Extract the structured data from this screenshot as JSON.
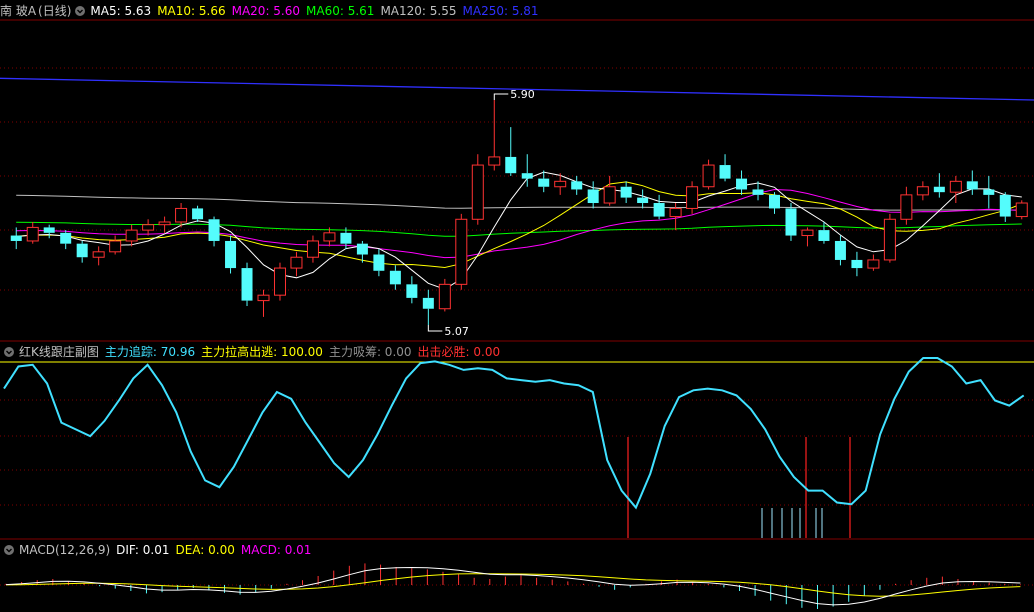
{
  "price_panel": {
    "stock_name": "南 玻A",
    "period": "(日线)",
    "ma_items": [
      {
        "label": "MA5: 5.63",
        "color": "#ffffff"
      },
      {
        "label": "MA10: 5.66",
        "color": "#ffff00"
      },
      {
        "label": "MA20: 5.60",
        "color": "#ff00ff"
      },
      {
        "label": "MA60: 5.61",
        "color": "#00ff00"
      },
      {
        "label": "MA120: 5.55",
        "color": "#c0c0c0"
      },
      {
        "label": "MA250: 5.81",
        "color": "#3030ff"
      }
    ],
    "high_label": "5.90",
    "low_label": "5.07"
  },
  "indicator_panel": {
    "title": "红K线跟庄副图",
    "items": [
      {
        "label": "主力追踪: 70.96",
        "color": "#40e0ff"
      },
      {
        "label": "主力拉高出逃: 100.00",
        "color": "#ffff00"
      },
      {
        "label": "主力吸筹: 0.00",
        "color": "#909090"
      },
      {
        "label": "出击必胜: 0.00",
        "color": "#ff3030"
      }
    ]
  },
  "macd_panel": {
    "title": "MACD(12,26,9)",
    "items": [
      {
        "label": "DIF: 0.01",
        "color": "#ffffff"
      },
      {
        "label": "DEA: 0.00",
        "color": "#ffff00"
      },
      {
        "label": "MACD: 0.01",
        "color": "#ff00ff"
      }
    ]
  },
  "colors": {
    "up": "#ff3232",
    "down": "#54fcfc",
    "grid": "#800000",
    "track": "#40e0ff"
  },
  "chart_data": {
    "type": "candlestick",
    "price_range": [
      5.07,
      5.9
    ],
    "candles": [
      [
        5.4,
        5.43,
        5.35,
        5.38
      ],
      [
        5.38,
        5.45,
        5.37,
        5.43
      ],
      [
        5.43,
        5.44,
        5.39,
        5.41
      ],
      [
        5.41,
        5.42,
        5.35,
        5.37
      ],
      [
        5.37,
        5.38,
        5.3,
        5.32
      ],
      [
        5.32,
        5.36,
        5.29,
        5.34
      ],
      [
        5.34,
        5.4,
        5.33,
        5.38
      ],
      [
        5.38,
        5.44,
        5.36,
        5.42
      ],
      [
        5.42,
        5.46,
        5.4,
        5.44
      ],
      [
        5.44,
        5.47,
        5.41,
        5.45
      ],
      [
        5.45,
        5.52,
        5.43,
        5.5
      ],
      [
        5.5,
        5.51,
        5.45,
        5.46
      ],
      [
        5.46,
        5.47,
        5.36,
        5.38
      ],
      [
        5.38,
        5.4,
        5.26,
        5.28
      ],
      [
        5.28,
        5.3,
        5.14,
        5.16
      ],
      [
        5.16,
        5.2,
        5.1,
        5.18
      ],
      [
        5.18,
        5.3,
        5.16,
        5.28
      ],
      [
        5.28,
        5.34,
        5.25,
        5.32
      ],
      [
        5.32,
        5.4,
        5.3,
        5.38
      ],
      [
        5.38,
        5.43,
        5.36,
        5.41
      ],
      [
        5.41,
        5.43,
        5.35,
        5.37
      ],
      [
        5.37,
        5.38,
        5.3,
        5.33
      ],
      [
        5.33,
        5.35,
        5.25,
        5.27
      ],
      [
        5.27,
        5.29,
        5.2,
        5.22
      ],
      [
        5.22,
        5.25,
        5.15,
        5.17
      ],
      [
        5.17,
        5.2,
        5.07,
        5.13
      ],
      [
        5.13,
        5.24,
        5.12,
        5.22
      ],
      [
        5.22,
        5.48,
        5.2,
        5.46
      ],
      [
        5.46,
        5.7,
        5.44,
        5.66
      ],
      [
        5.66,
        5.9,
        5.64,
        5.69
      ],
      [
        5.69,
        5.8,
        5.62,
        5.63
      ],
      [
        5.63,
        5.7,
        5.58,
        5.61
      ],
      [
        5.61,
        5.64,
        5.56,
        5.58
      ],
      [
        5.58,
        5.63,
        5.55,
        5.6
      ],
      [
        5.6,
        5.62,
        5.55,
        5.57
      ],
      [
        5.57,
        5.6,
        5.5,
        5.52
      ],
      [
        5.52,
        5.62,
        5.51,
        5.58
      ],
      [
        5.58,
        5.6,
        5.52,
        5.54
      ],
      [
        5.54,
        5.57,
        5.5,
        5.52
      ],
      [
        5.52,
        5.55,
        5.46,
        5.47
      ],
      [
        5.47,
        5.52,
        5.42,
        5.5
      ],
      [
        5.5,
        5.6,
        5.48,
        5.58
      ],
      [
        5.58,
        5.68,
        5.57,
        5.66
      ],
      [
        5.66,
        5.7,
        5.6,
        5.61
      ],
      [
        5.61,
        5.64,
        5.55,
        5.57
      ],
      [
        5.57,
        5.6,
        5.53,
        5.55
      ],
      [
        5.55,
        5.56,
        5.48,
        5.5
      ],
      [
        5.5,
        5.52,
        5.38,
        5.4
      ],
      [
        5.4,
        5.43,
        5.36,
        5.42
      ],
      [
        5.42,
        5.45,
        5.37,
        5.38
      ],
      [
        5.38,
        5.4,
        5.29,
        5.31
      ],
      [
        5.31,
        5.34,
        5.25,
        5.28
      ],
      [
        5.28,
        5.33,
        5.27,
        5.31
      ],
      [
        5.31,
        5.48,
        5.3,
        5.46
      ],
      [
        5.46,
        5.58,
        5.44,
        5.55
      ],
      [
        5.55,
        5.6,
        5.53,
        5.58
      ],
      [
        5.58,
        5.63,
        5.54,
        5.56
      ],
      [
        5.56,
        5.62,
        5.52,
        5.6
      ],
      [
        5.6,
        5.64,
        5.55,
        5.57
      ],
      [
        5.57,
        5.62,
        5.5,
        5.55
      ],
      [
        5.55,
        5.56,
        5.45,
        5.47
      ],
      [
        5.47,
        5.53,
        5.46,
        5.52
      ]
    ],
    "ma250": [
      5.98,
      5.9
    ],
    "indicator_track": [
      82,
      95,
      96,
      85,
      62,
      58,
      54,
      63,
      75,
      88,
      96,
      84,
      68,
      45,
      28,
      24,
      36,
      52,
      68,
      80,
      76,
      62,
      50,
      38,
      30,
      40,
      55,
      72,
      88,
      97,
      98,
      96,
      93,
      94,
      93,
      88,
      87,
      86,
      87,
      85,
      84,
      80,
      40,
      22,
      12,
      32,
      60,
      77,
      81,
      82,
      81,
      78,
      70,
      58,
      42,
      30,
      22,
      22,
      15,
      14,
      22,
      55,
      76,
      92,
      100,
      100,
      95,
      85,
      87,
      75,
      72,
      78
    ],
    "macd_hist": [
      0.2,
      0.5,
      0.8,
      1.0,
      0.6,
      0.3,
      -0.2,
      -0.6,
      -1.0,
      -1.4,
      -1.2,
      -0.8,
      -0.5,
      -0.9,
      -1.3,
      -1.6,
      -1.2,
      -0.6,
      0.2,
      0.8,
      1.5,
      2.4,
      3.2,
      3.6,
      3.4,
      3.0,
      2.8,
      2.6,
      2.2,
      1.8,
      1.2,
      1.0,
      1.4,
      1.6,
      1.2,
      0.9,
      0.6,
      0.2,
      -0.3,
      -0.8,
      -0.4,
      0.2,
      0.6,
      0.9,
      0.5,
      0.2,
      -0.4,
      -1.0,
      -1.8,
      -2.6,
      -3.2,
      -3.8,
      -4.0,
      -3.6,
      -2.8,
      -1.8,
      -0.8,
      0.2,
      0.8,
      1.2,
      1.4,
      1.0,
      0.6,
      0.4,
      0.2,
      0.1
    ]
  }
}
